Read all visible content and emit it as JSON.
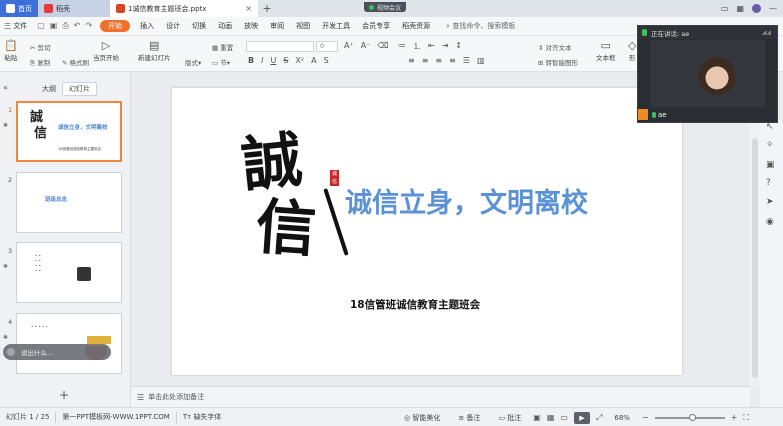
{
  "tabs": {
    "home": "首页",
    "docer": "稻壳",
    "doc": "1诚信教育主题班会.pptx",
    "new_tab": "+"
  },
  "meeting": {
    "label": "视频会议"
  },
  "menu": {
    "file": "三 文件",
    "items": [
      "开始",
      "插入",
      "设计",
      "切换",
      "动画",
      "放映",
      "审阅",
      "视图",
      "开发工具",
      "会员专享",
      "稻壳资源"
    ],
    "search": "查找命令、搜索模板"
  },
  "ribbon": {
    "paste": "粘贴",
    "cut": "剪切",
    "copy": "复制",
    "format_painter": "格式刷",
    "from_current": "当页开始",
    "new_slide": "新建幻灯片",
    "layout": "版式",
    "section": "节",
    "reset": "重置",
    "font_placeholder": "",
    "size_placeholder": "0",
    "align_text": "对齐文本",
    "to_smartart": "转智能图形",
    "textbox": "文本框",
    "shape": "形"
  },
  "left_panel": {
    "tab_outline": "大纲",
    "tab_slides": "幻灯片",
    "slides": [
      {
        "num": "1",
        "title": "诚信立身，文明离校",
        "sub": "18信管班诚信教育主题班会"
      },
      {
        "num": "2",
        "title": "班级总念"
      },
      {
        "num": "3"
      },
      {
        "num": "4"
      }
    ],
    "speaker_hint": "说出什么..."
  },
  "slide": {
    "calligraphy_top": "誠",
    "calligraphy_bottom": "信",
    "seal": "诚信",
    "title": "诚信立身，文明离校",
    "subtitle": "18信管班诚信教育主题班会"
  },
  "notes": {
    "placeholder": "单击此处添加备注"
  },
  "video": {
    "header": "正在讲话: ae",
    "name": "ae"
  },
  "status": {
    "slide_count": "幻灯片 1 / 25",
    "template": "第一PPT模板网-WWW.1PPT.COM",
    "missing_font": "缺失字体",
    "smart_beautify": "智能美化",
    "notes": "备注",
    "comments": "批注",
    "zoom": "68%"
  },
  "icons": {
    "play": "play-icon",
    "zoom_minus": "minus-icon",
    "zoom_plus": "plus-icon"
  }
}
